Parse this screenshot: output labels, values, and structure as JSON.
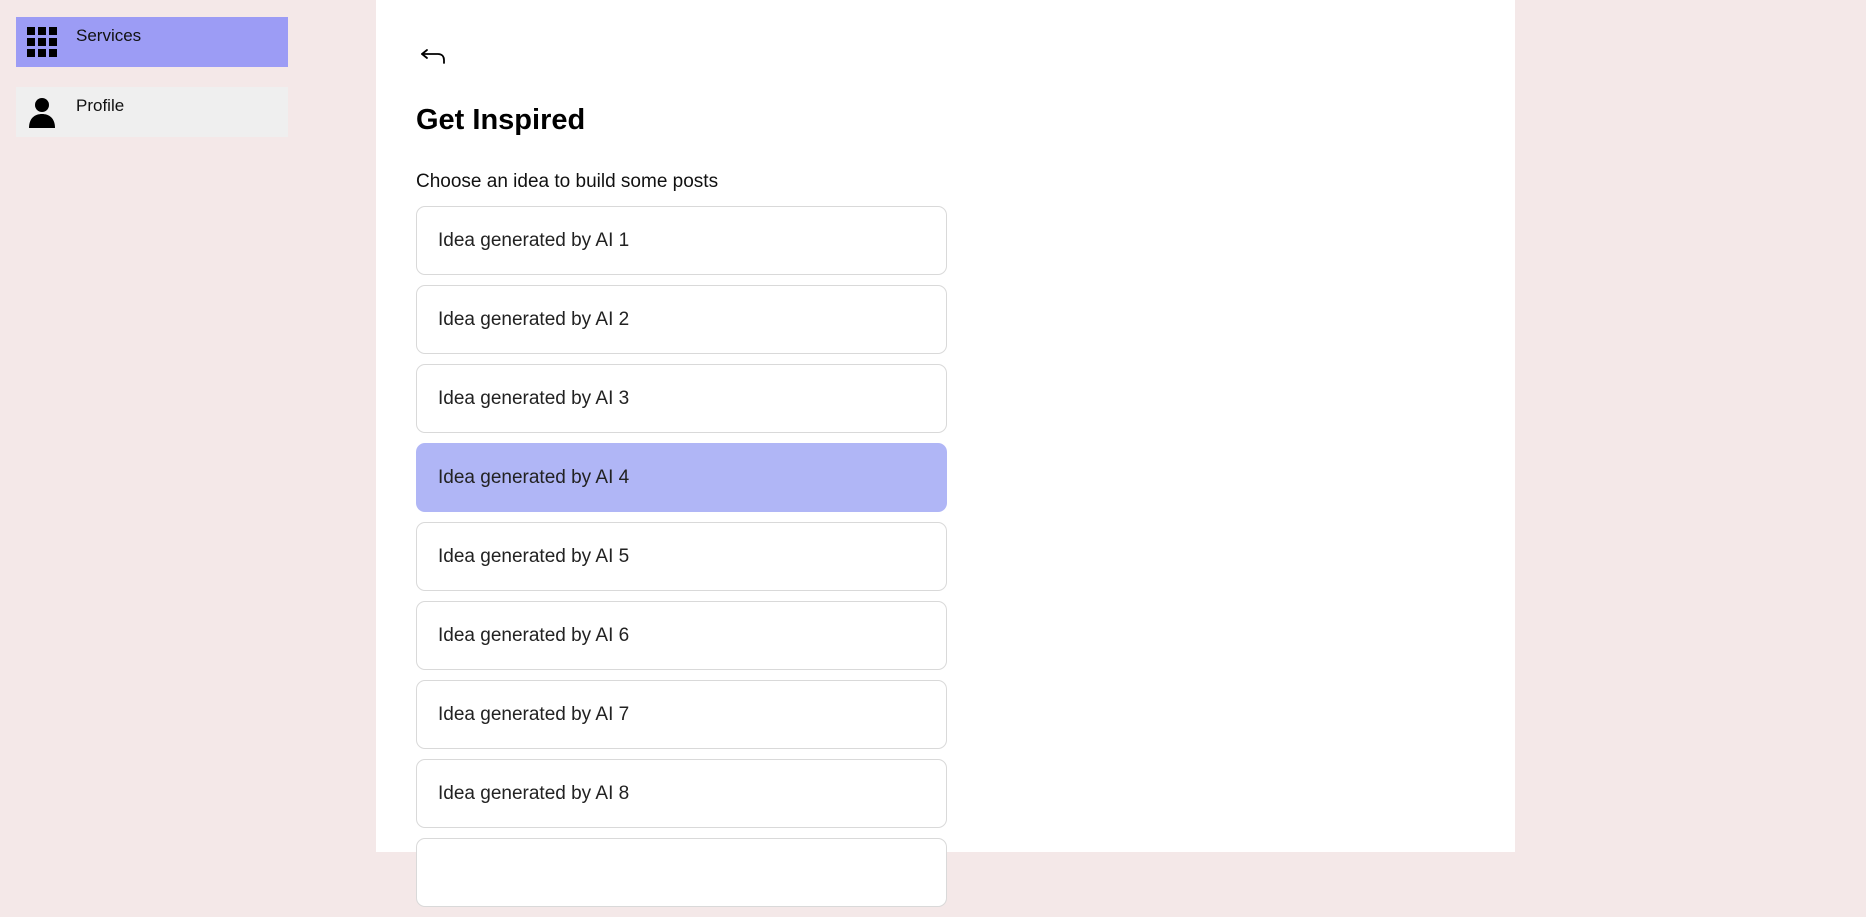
{
  "sidebar": {
    "items": [
      {
        "label": "Services",
        "icon": "grid-icon",
        "active": true
      },
      {
        "label": "Profile",
        "icon": "person-icon",
        "active": false
      }
    ]
  },
  "main": {
    "back_icon": "back-arrow-icon",
    "title": "Get Inspired",
    "subtitle": "Choose an idea to build some posts",
    "ideas": [
      "Idea generated by AI 1",
      "Idea generated by AI 2",
      "Idea generated by AI 3",
      "Idea generated by AI 4",
      "Idea generated by AI 5",
      "Idea generated by AI 6",
      "Idea generated by AI 7",
      "Idea generated by AI 8",
      ""
    ],
    "selected_index": 3
  },
  "colors": {
    "page_background": "#f4e8e8",
    "active_nav": "#9c9cf5",
    "inactive_nav": "#efefef",
    "selected_idea": "#b0b6f6"
  }
}
